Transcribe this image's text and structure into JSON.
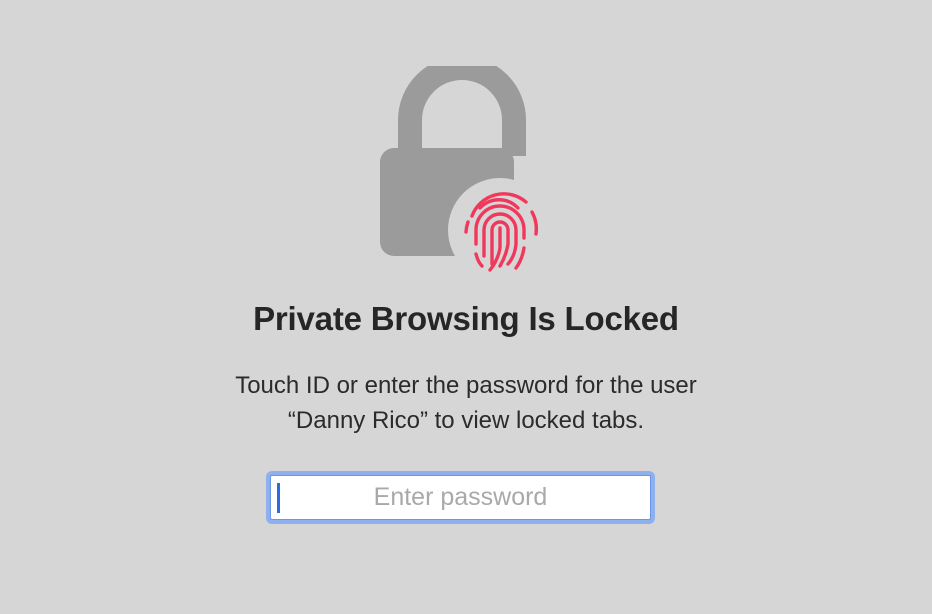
{
  "lock_screen": {
    "icon": "lock-with-touch-id-icon",
    "accent_color": "#f0385c",
    "lock_color": "#9b9b9b",
    "title": "Private Browsing Is Locked",
    "message_line1": "Touch ID or enter the password for the user",
    "message_line2": "“Danny Rico” to view locked tabs.",
    "password": {
      "placeholder": "Enter password",
      "value": ""
    }
  }
}
